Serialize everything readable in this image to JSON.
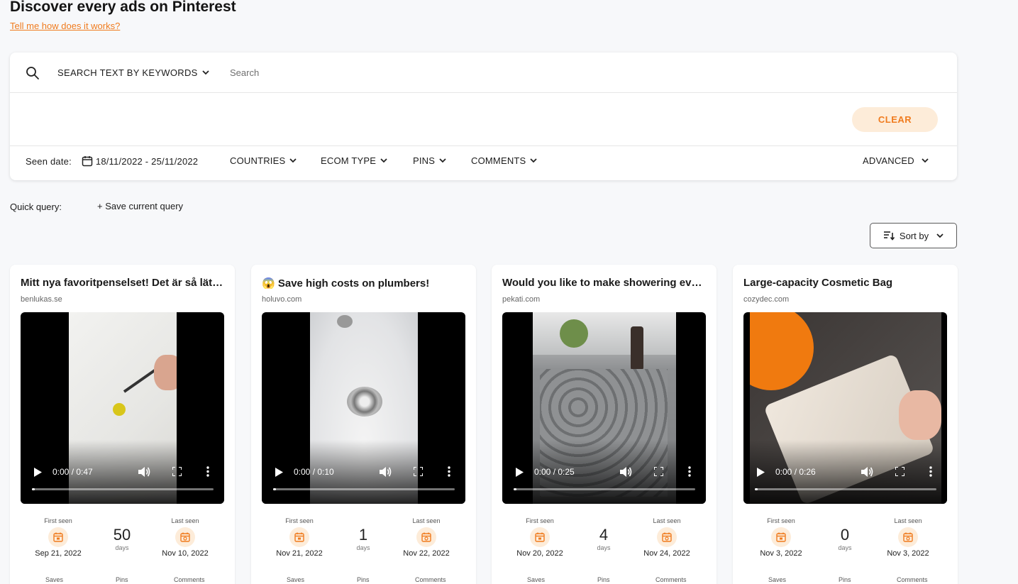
{
  "header": {
    "title": "Discover every ads on Pinterest",
    "help_link": "Tell me how does it works?"
  },
  "search": {
    "mode_label": "SEARCH TEXT BY KEYWORDS",
    "placeholder": "Search",
    "clear_label": "CLEAR"
  },
  "filters": {
    "seen_date_label": "Seen date:",
    "seen_date_value": "18/11/2022 - 25/11/2022",
    "countries": "COUNTRIES",
    "ecom_type": "ECOM TYPE",
    "pins": "PINS",
    "comments": "COMMENTS",
    "advanced": "ADVANCED"
  },
  "quick_query": {
    "label": "Quick query:",
    "save_label": "+ Save current query"
  },
  "sort": {
    "label": "Sort by"
  },
  "stat_labels": {
    "first_seen": "First seen",
    "last_seen": "Last seen",
    "days": "days",
    "saves": "Saves",
    "pins": "Pins",
    "comments": "Comments"
  },
  "colors": {
    "accent": "#f07b1e",
    "accent_light": "#fdecd9"
  },
  "cards": [
    {
      "title": "Mitt nya favoritpenselset! Det är så lätt att använda",
      "domain": "benlukas.se",
      "time": "0:00 / 0:47",
      "first_seen": "Sep 21, 2022",
      "days": "50",
      "last_seen": "Nov 10, 2022"
    },
    {
      "title": "😱 Save high costs on plumbers!",
      "domain": "holuvo.com",
      "time": "0:00 / 0:10",
      "first_seen": "Nov 21, 2022",
      "days": "1",
      "last_seen": "Nov 22, 2022"
    },
    {
      "title": "Would you like to make showering even more relaxing?",
      "domain": "pekati.com",
      "time": "0:00 / 0:25",
      "first_seen": "Nov 20, 2022",
      "days": "4",
      "last_seen": "Nov 24, 2022"
    },
    {
      "title": "Large-capacity Cosmetic Bag",
      "domain": "cozydec.com",
      "time": "0:00 / 0:26",
      "first_seen": "Nov 3, 2022",
      "days": "0",
      "last_seen": "Nov 3, 2022"
    }
  ]
}
